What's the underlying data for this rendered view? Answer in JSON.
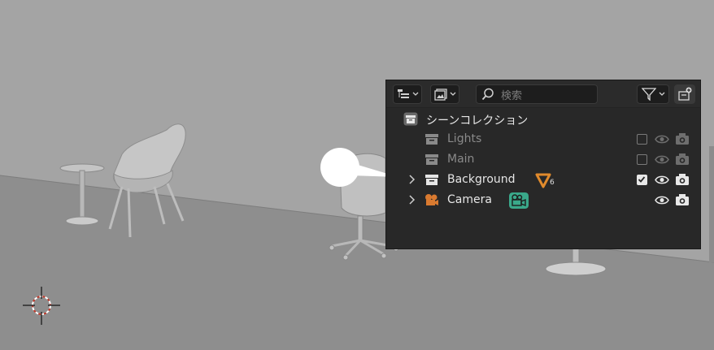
{
  "outliner": {
    "search_placeholder": "検索",
    "rows": [
      {
        "label": "シーンコレクション"
      },
      {
        "label": "Lights"
      },
      {
        "label": "Main"
      },
      {
        "label": "Background",
        "badge_count": "6"
      },
      {
        "label": "Camera"
      }
    ]
  },
  "icons": {
    "display_mode": "outliner-display-mode-icon",
    "view_layer": "view-layer-icon",
    "search": "search-icon",
    "filter": "filter-icon",
    "new_collection": "new-collection-icon"
  },
  "colors": {
    "panel_bg": "#282828",
    "mesh_badge": "#e08a2c",
    "camera_badge": "#3aa88a",
    "camera_icon": "#d97a30"
  }
}
